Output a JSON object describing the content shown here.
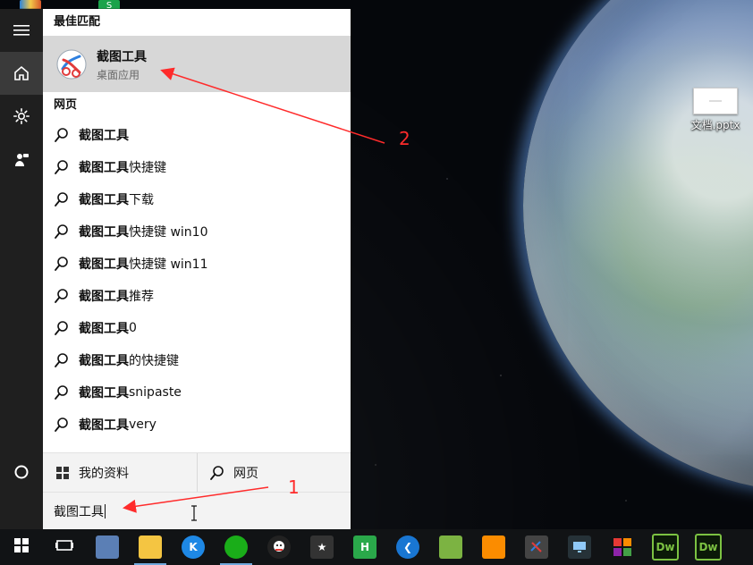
{
  "colors": {
    "start_bg": "#f3f3f3",
    "rail_bg": "#1f1f1f",
    "selected_bg": "#d7d7d7",
    "taskbar_bg": "#111315",
    "annotation": "#ff2b2b"
  },
  "desktop": {
    "file_label": "文档.pptx",
    "top_icon_letter": "S"
  },
  "start_menu": {
    "best_match_title": "最佳匹配",
    "best_match": {
      "name": "截图工具",
      "type": "桌面应用",
      "icon": "scissors-snipping-icon"
    },
    "web_title": "网页",
    "web_results": [
      {
        "bold": "截图工具",
        "rest": ""
      },
      {
        "bold": "截图工具",
        "rest": "快捷键"
      },
      {
        "bold": "截图工具",
        "rest": "下载"
      },
      {
        "bold": "截图工具",
        "rest": "快捷键 win10"
      },
      {
        "bold": "截图工具",
        "rest": "快捷键 win11"
      },
      {
        "bold": "截图工具",
        "rest": "推荐"
      },
      {
        "bold": "截图工具",
        "rest": "0"
      },
      {
        "bold": "截图工具",
        "rest": "的快捷键"
      },
      {
        "bold": "截图工具",
        "rest": "snipaste"
      },
      {
        "bold": "截图工具",
        "rest": " very"
      }
    ],
    "filters": {
      "my_stuff": "我的资料",
      "web": "网页"
    },
    "search_value": "截图工具"
  },
  "left_rail": {
    "items": [
      "hamburger-menu-icon",
      "home-icon",
      "settings-gear-icon",
      "feedback-person-icon",
      "cortana-circle-icon"
    ]
  },
  "annotations": {
    "one": "1",
    "two": "2"
  },
  "taskbar": {
    "items": [
      {
        "name": "start-windows",
        "text": ""
      },
      {
        "name": "task-view",
        "text": ""
      },
      {
        "name": "computer-app",
        "text": ""
      },
      {
        "name": "file-explorer",
        "text": ""
      },
      {
        "name": "kugou",
        "text": "K"
      },
      {
        "name": "wechat",
        "text": ""
      },
      {
        "name": "qq",
        "text": ""
      },
      {
        "name": "media-app",
        "text": ""
      },
      {
        "name": "hbuilder",
        "text": "H"
      },
      {
        "name": "blue-app",
        "text": ""
      },
      {
        "name": "green-app",
        "text": ""
      },
      {
        "name": "orange-app",
        "text": ""
      },
      {
        "name": "screenshot-tool",
        "text": ""
      },
      {
        "name": "remote-desktop",
        "text": ""
      },
      {
        "name": "colorful-app",
        "text": ""
      },
      {
        "name": "dreamweaver-1",
        "text": "Dw"
      },
      {
        "name": "dreamweaver-2",
        "text": "Dw"
      }
    ]
  }
}
